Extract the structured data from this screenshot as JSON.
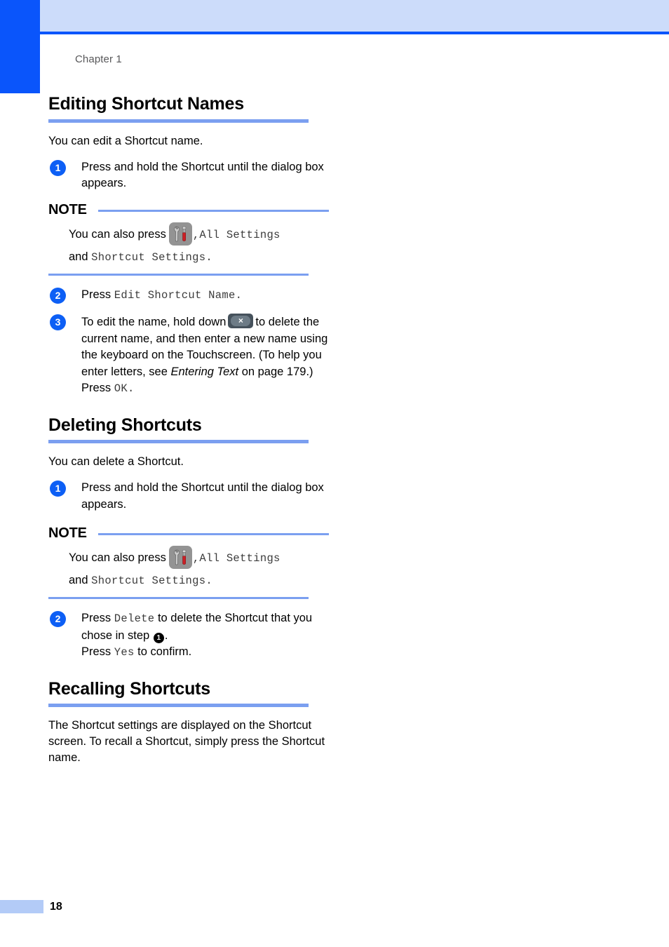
{
  "page": {
    "chapter_label": "Chapter 1",
    "page_number": "18",
    "colors": {
      "accent_blue": "#0a55fb",
      "header_band": "#ccdcfa",
      "rule_blue": "#7b9ff0",
      "footer_block": "#b3cbf7",
      "mono_text": "#3b3b3b",
      "icon_body": "#939393",
      "icon_screwdriver": "#cc2026",
      "backspace_key": "#46525c"
    }
  },
  "sections": [
    {
      "title": "Editing Shortcut Names",
      "intro": "You can edit a Shortcut name.",
      "steps": [
        {
          "number": "1",
          "text": "Press and hold the Shortcut until the dialog box appears."
        }
      ],
      "note": {
        "label": "NOTE",
        "line1_prefix": "You can also press",
        "icon": "settings-wrench-screwdriver-icon",
        "line1_mono": ",All Settings",
        "line2_prefix": "and",
        "line2_mono": "Shortcut Settings."
      },
      "steps_after_note": [
        {
          "number": "2",
          "prefix": "Press ",
          "mono": "Edit Shortcut Name."
        },
        {
          "number": "3",
          "part1": "To edit the name, hold down",
          "icon": "backspace-key-icon",
          "icon_glyph": "×",
          "part2": "to delete the current name, and then enter a new name using the keyboard on the Touchscreen. (To help you enter letters, see ",
          "italic_ref": "Entering Text",
          "part3": " on page 179.)",
          "part4": "Press ",
          "mono_tail": "OK."
        }
      ]
    },
    {
      "title": "Deleting Shortcuts",
      "intro": "You can delete a Shortcut.",
      "steps": [
        {
          "number": "1",
          "text": "Press and hold the Shortcut until the dialog box appears."
        }
      ],
      "note": {
        "label": "NOTE",
        "line1_prefix": "You can also press",
        "icon": "settings-wrench-screwdriver-icon",
        "line1_mono": ",All Settings",
        "line2_prefix": "and",
        "line2_mono": "Shortcut Settings."
      },
      "steps_after_note": [
        {
          "number": "2",
          "part1": "Press ",
          "mono1": "Delete",
          "part2": " to delete the Shortcut that you chose in step ",
          "step_mark": "1",
          "part3": ".",
          "part4": "Press ",
          "mono2": "Yes",
          "part5": " to confirm."
        }
      ]
    },
    {
      "title": "Recalling Shortcuts",
      "intro": "The Shortcut settings are displayed on the Shortcut screen. To recall a Shortcut, simply press the Shortcut name."
    }
  ]
}
